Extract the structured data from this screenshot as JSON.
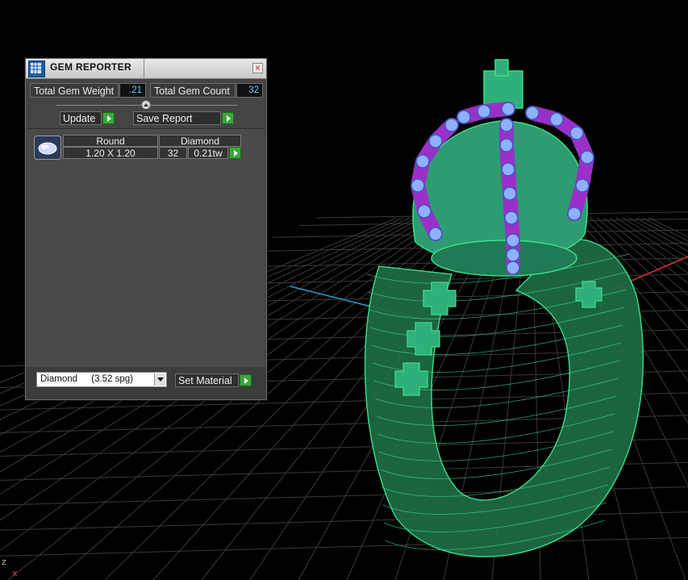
{
  "viewport": {
    "axis_z_label": "z",
    "axis_x_label": "x",
    "colors": {
      "background": "#000000",
      "grid": "#3a3a3a",
      "ring": "#3ce08a",
      "prongs": "#9b30c8",
      "gems": "#8fb0ff",
      "axis_x": "#d03030",
      "axis_z": "#2aa0c8"
    }
  },
  "panel": {
    "title": "GEM REPORTER",
    "icon": "gem-reporter-icon",
    "close_icon": "close-icon",
    "total_weight_label": "Total Gem Weight",
    "total_weight_value": ".21",
    "total_count_label": "Total Gem Count",
    "total_count_value": "32",
    "update_label": "Update",
    "save_report_label": "Save Report",
    "gems": [
      {
        "shape": "Round",
        "size": "1.20 X 1.20",
        "material": "Diamond",
        "count": "32",
        "weight": "0.21tw"
      }
    ],
    "material_select": {
      "name": "Diamond",
      "spg": "(3.52 spg)"
    },
    "set_material_label": "Set Material"
  }
}
